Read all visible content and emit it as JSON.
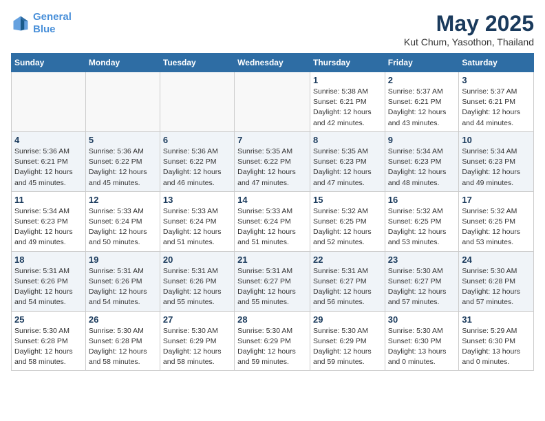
{
  "header": {
    "logo_line1": "General",
    "logo_line2": "Blue",
    "month": "May 2025",
    "location": "Kut Chum, Yasothon, Thailand"
  },
  "weekdays": [
    "Sunday",
    "Monday",
    "Tuesday",
    "Wednesday",
    "Thursday",
    "Friday",
    "Saturday"
  ],
  "weeks": [
    [
      {
        "day": "",
        "info": ""
      },
      {
        "day": "",
        "info": ""
      },
      {
        "day": "",
        "info": ""
      },
      {
        "day": "",
        "info": ""
      },
      {
        "day": "1",
        "info": "Sunrise: 5:38 AM\nSunset: 6:21 PM\nDaylight: 12 hours\nand 42 minutes."
      },
      {
        "day": "2",
        "info": "Sunrise: 5:37 AM\nSunset: 6:21 PM\nDaylight: 12 hours\nand 43 minutes."
      },
      {
        "day": "3",
        "info": "Sunrise: 5:37 AM\nSunset: 6:21 PM\nDaylight: 12 hours\nand 44 minutes."
      }
    ],
    [
      {
        "day": "4",
        "info": "Sunrise: 5:36 AM\nSunset: 6:21 PM\nDaylight: 12 hours\nand 45 minutes."
      },
      {
        "day": "5",
        "info": "Sunrise: 5:36 AM\nSunset: 6:22 PM\nDaylight: 12 hours\nand 45 minutes."
      },
      {
        "day": "6",
        "info": "Sunrise: 5:36 AM\nSunset: 6:22 PM\nDaylight: 12 hours\nand 46 minutes."
      },
      {
        "day": "7",
        "info": "Sunrise: 5:35 AM\nSunset: 6:22 PM\nDaylight: 12 hours\nand 47 minutes."
      },
      {
        "day": "8",
        "info": "Sunrise: 5:35 AM\nSunset: 6:23 PM\nDaylight: 12 hours\nand 47 minutes."
      },
      {
        "day": "9",
        "info": "Sunrise: 5:34 AM\nSunset: 6:23 PM\nDaylight: 12 hours\nand 48 minutes."
      },
      {
        "day": "10",
        "info": "Sunrise: 5:34 AM\nSunset: 6:23 PM\nDaylight: 12 hours\nand 49 minutes."
      }
    ],
    [
      {
        "day": "11",
        "info": "Sunrise: 5:34 AM\nSunset: 6:23 PM\nDaylight: 12 hours\nand 49 minutes."
      },
      {
        "day": "12",
        "info": "Sunrise: 5:33 AM\nSunset: 6:24 PM\nDaylight: 12 hours\nand 50 minutes."
      },
      {
        "day": "13",
        "info": "Sunrise: 5:33 AM\nSunset: 6:24 PM\nDaylight: 12 hours\nand 51 minutes."
      },
      {
        "day": "14",
        "info": "Sunrise: 5:33 AM\nSunset: 6:24 PM\nDaylight: 12 hours\nand 51 minutes."
      },
      {
        "day": "15",
        "info": "Sunrise: 5:32 AM\nSunset: 6:25 PM\nDaylight: 12 hours\nand 52 minutes."
      },
      {
        "day": "16",
        "info": "Sunrise: 5:32 AM\nSunset: 6:25 PM\nDaylight: 12 hours\nand 53 minutes."
      },
      {
        "day": "17",
        "info": "Sunrise: 5:32 AM\nSunset: 6:25 PM\nDaylight: 12 hours\nand 53 minutes."
      }
    ],
    [
      {
        "day": "18",
        "info": "Sunrise: 5:31 AM\nSunset: 6:26 PM\nDaylight: 12 hours\nand 54 minutes."
      },
      {
        "day": "19",
        "info": "Sunrise: 5:31 AM\nSunset: 6:26 PM\nDaylight: 12 hours\nand 54 minutes."
      },
      {
        "day": "20",
        "info": "Sunrise: 5:31 AM\nSunset: 6:26 PM\nDaylight: 12 hours\nand 55 minutes."
      },
      {
        "day": "21",
        "info": "Sunrise: 5:31 AM\nSunset: 6:27 PM\nDaylight: 12 hours\nand 55 minutes."
      },
      {
        "day": "22",
        "info": "Sunrise: 5:31 AM\nSunset: 6:27 PM\nDaylight: 12 hours\nand 56 minutes."
      },
      {
        "day": "23",
        "info": "Sunrise: 5:30 AM\nSunset: 6:27 PM\nDaylight: 12 hours\nand 57 minutes."
      },
      {
        "day": "24",
        "info": "Sunrise: 5:30 AM\nSunset: 6:28 PM\nDaylight: 12 hours\nand 57 minutes."
      }
    ],
    [
      {
        "day": "25",
        "info": "Sunrise: 5:30 AM\nSunset: 6:28 PM\nDaylight: 12 hours\nand 58 minutes."
      },
      {
        "day": "26",
        "info": "Sunrise: 5:30 AM\nSunset: 6:28 PM\nDaylight: 12 hours\nand 58 minutes."
      },
      {
        "day": "27",
        "info": "Sunrise: 5:30 AM\nSunset: 6:29 PM\nDaylight: 12 hours\nand 58 minutes."
      },
      {
        "day": "28",
        "info": "Sunrise: 5:30 AM\nSunset: 6:29 PM\nDaylight: 12 hours\nand 59 minutes."
      },
      {
        "day": "29",
        "info": "Sunrise: 5:30 AM\nSunset: 6:29 PM\nDaylight: 12 hours\nand 59 minutes."
      },
      {
        "day": "30",
        "info": "Sunrise: 5:30 AM\nSunset: 6:30 PM\nDaylight: 13 hours\nand 0 minutes."
      },
      {
        "day": "31",
        "info": "Sunrise: 5:29 AM\nSunset: 6:30 PM\nDaylight: 13 hours\nand 0 minutes."
      }
    ]
  ]
}
